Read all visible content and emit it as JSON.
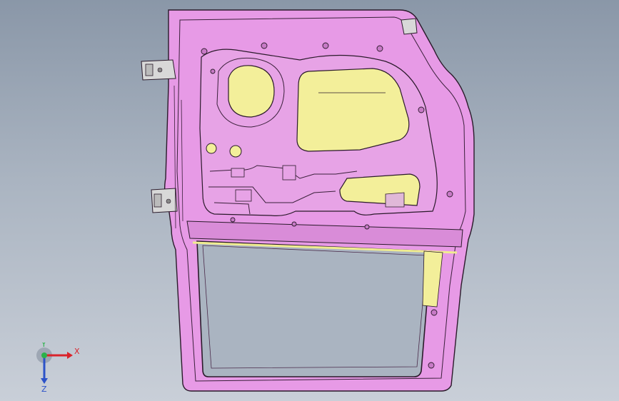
{
  "viewport": {
    "background_top": "#8a97a8",
    "background_bottom": "#c9cfd8"
  },
  "model": {
    "part_color": "#e79ae6",
    "part_edge_color": "#2a1a2a",
    "insert_color": "#f3ef9a",
    "hinge_color": "#d8d8d8"
  },
  "triad": {
    "x_label": "X",
    "y_label": "Y",
    "z_label": "Z",
    "x_color": "#d9232b",
    "y_color": "#2bb24a",
    "z_color": "#2c52c8"
  }
}
